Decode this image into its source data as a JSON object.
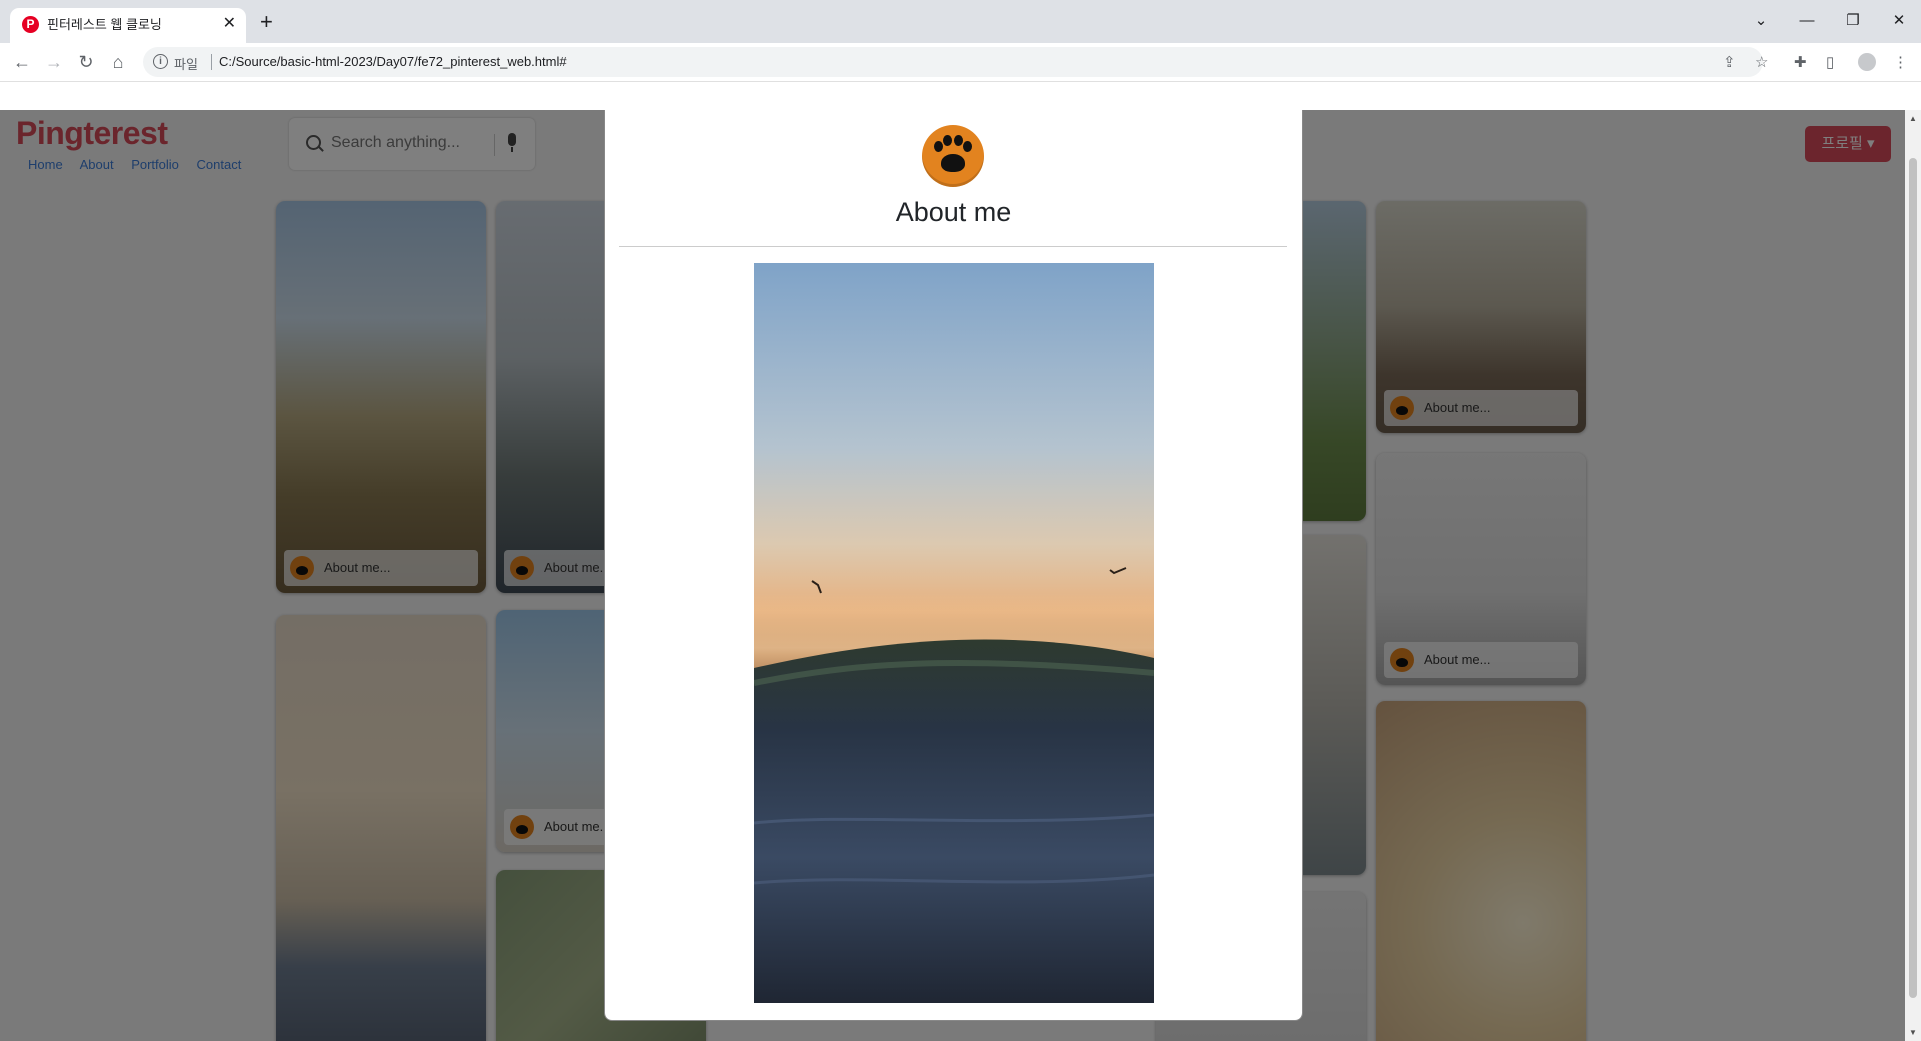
{
  "browser": {
    "tab_title": "핀터레스트 웹 클로닝",
    "tab_favicon": "P",
    "new_tab_symbol": "+",
    "close_symbol": "✕",
    "url_scheme_label": "파일",
    "url": "C:/Source/basic-html-2023/Day07/fe72_pinterest_web.html#",
    "nav_icons": [
      "back-arrow-icon",
      "forward-arrow-icon",
      "reload-icon",
      "home-icon"
    ],
    "toolbar_icons": [
      "share-icon",
      "star-icon",
      "extensions-icon",
      "side-panel-icon",
      "profile-icon",
      "menu-icon"
    ]
  },
  "site": {
    "logo": "Pingterest",
    "nav": [
      "Home",
      "About",
      "Portfolio",
      "Contact"
    ],
    "search_placeholder": "Search anything...",
    "profile_button": "프로필 ▾",
    "card_label": "About me..."
  },
  "modal": {
    "title": "About me",
    "icon": "paw-icon",
    "image": "sunset-ocean-wave-photo"
  },
  "colors": {
    "brand": "#d64a58",
    "icon_orange": "#e2831f",
    "link": "#3d7dd8"
  }
}
